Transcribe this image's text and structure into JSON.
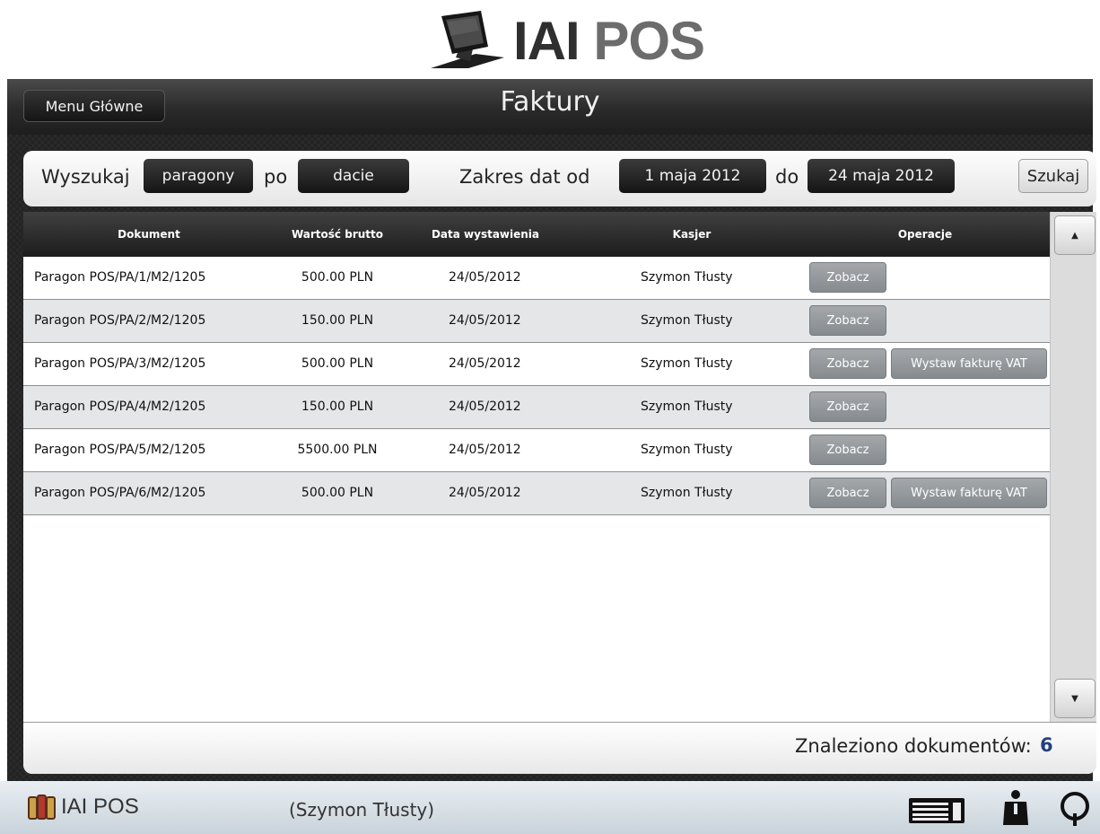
{
  "logo": {
    "text_a": "IAI",
    "text_b": " POS",
    "icon": "pos-terminal-icon"
  },
  "header": {
    "menu_button": "Menu Główne",
    "title": "Faktury"
  },
  "search": {
    "label_search": "Wyszukaj",
    "doc_type": "paragony",
    "label_by": "po",
    "criterion": "dacie",
    "label_range": "Zakres dat od",
    "date_from": "1 maja 2012",
    "label_to": "do",
    "date_to": "24 maja 2012",
    "search_button": "Szukaj"
  },
  "table": {
    "columns": [
      "Dokument",
      "Wartość brutto",
      "Data wystawienia",
      "Kasjer",
      "Operacje"
    ],
    "rows": [
      {
        "document": "Paragon POS/PA/1/M2/1205",
        "value": "500.00 PLN",
        "date": "24/05/2012",
        "cashier": "Szymon Tłusty",
        "view": "Zobacz",
        "invoice": ""
      },
      {
        "document": "Paragon POS/PA/2/M2/1205",
        "value": "150.00 PLN",
        "date": "24/05/2012",
        "cashier": "Szymon Tłusty",
        "view": "Zobacz",
        "invoice": ""
      },
      {
        "document": "Paragon POS/PA/3/M2/1205",
        "value": "500.00 PLN",
        "date": "24/05/2012",
        "cashier": "Szymon Tłusty",
        "view": "Zobacz",
        "invoice": "Wystaw fakturę VAT"
      },
      {
        "document": "Paragon POS/PA/4/M2/1205",
        "value": "150.00 PLN",
        "date": "24/05/2012",
        "cashier": "Szymon Tłusty",
        "view": "Zobacz",
        "invoice": ""
      },
      {
        "document": "Paragon POS/PA/5/M2/1205",
        "value": "5500.00 PLN",
        "date": "24/05/2012",
        "cashier": "Szymon Tłusty",
        "view": "Zobacz",
        "invoice": ""
      },
      {
        "document": "Paragon POS/PA/6/M2/1205",
        "value": "500.00 PLN",
        "date": "24/05/2012",
        "cashier": "Szymon Tłusty",
        "view": "Zobacz",
        "invoice": "Wystaw fakturę VAT"
      }
    ]
  },
  "scroll": {
    "up_glyph": "▲",
    "down_glyph": "▼"
  },
  "footer": {
    "found_label": "Znaleziono dokumentów:",
    "found_count": "6"
  },
  "statusbar": {
    "brand": "IAI POS",
    "user": "(Szymon Tłusty)",
    "icons": [
      "keyboard-icon",
      "user-icon",
      "help-icon"
    ]
  },
  "colors": {
    "frame_dark": "#222222",
    "count_blue": "#23407a",
    "op_button_gray": "#969a9e",
    "row_alt": "#e4e6e8"
  }
}
